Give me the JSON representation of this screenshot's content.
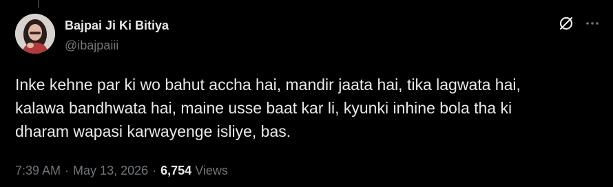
{
  "tweet": {
    "author": {
      "display_name": "Bajpai Ji Ki Bitiya",
      "handle": "@ibajpaiii"
    },
    "text": "Inke kehne par ki wo bahut accha hai, mandir jaata hai, tika lagwata hai,\nkalawa bandhwata hai, maine usse baat kar li, kyunki inhine bola tha ki\ndharam wapasi karwayenge isliye, bas.",
    "time": "7:39 AM",
    "date": "May 13, 2026",
    "separator": "·",
    "views_count": "6,754",
    "views_label": "Views",
    "more_glyph": "···"
  },
  "icons": {
    "grok": "grok-slash-circle-icon",
    "more": "more-horizontal-icon"
  },
  "colors": {
    "background": "#000000",
    "primary_text": "#e7e9ea",
    "secondary_text": "#71767b",
    "thread_line": "#333639"
  }
}
